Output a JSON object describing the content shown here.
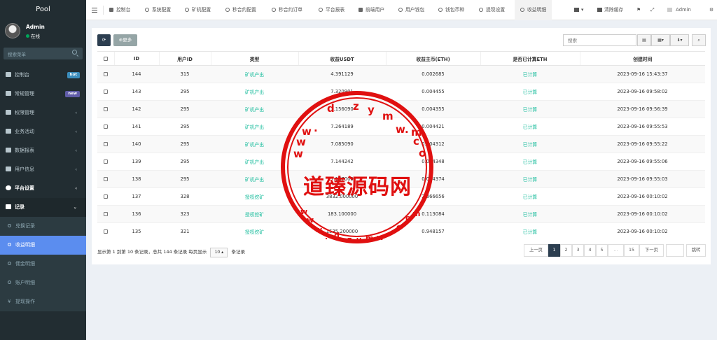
{
  "brand": "Pool",
  "user": {
    "name": "Admin",
    "status": "在线"
  },
  "sidebar": {
    "search_placeholder": "搜索菜单",
    "items": [
      {
        "label": "控制台",
        "badge": "hot",
        "badge_color": "#3c8dbc"
      },
      {
        "label": "常规管理",
        "badge": "new",
        "badge_color": "#605ca8"
      },
      {
        "label": "权限管理"
      },
      {
        "label": "业务活动"
      },
      {
        "label": "数据报表"
      },
      {
        "label": "用户信息"
      },
      {
        "label": "平台设置"
      },
      {
        "label": "记录"
      }
    ],
    "sub_items": [
      {
        "label": "兑换记录"
      },
      {
        "label": "收益明细"
      },
      {
        "label": "佣金明细"
      },
      {
        "label": "账户明细"
      },
      {
        "label": "提现操作"
      }
    ]
  },
  "topnav": {
    "tabs": [
      "控制台",
      "系统配置",
      "矿机配置",
      "秒合约配置",
      "秒合约订单",
      "平台报表",
      "前端用户",
      "用户钱包",
      "钱包币种",
      "提现设置",
      "收益明细"
    ],
    "clear_cache": "清除缓存",
    "admin": "Admin"
  },
  "toolbar": {
    "more_label": "更多",
    "search_placeholder": "搜索"
  },
  "table": {
    "headers": [
      "ID",
      "用户ID",
      "类型",
      "收益USDT",
      "收益主币(ETH)",
      "是否已计算ETH",
      "创建时间"
    ],
    "rows": [
      {
        "id": "144",
        "uid": "315",
        "type": "矿机产出",
        "usdt": "4.391129",
        "eth": "0.002685",
        "calc": "已计算",
        "time": "2023-09-16 15:43:37"
      },
      {
        "id": "143",
        "uid": "295",
        "type": "矿机产出",
        "usdt": "7.320901",
        "eth": "0.004455",
        "calc": "已计算",
        "time": "2023-09-16 09:58:02"
      },
      {
        "id": "142",
        "uid": "295",
        "type": "矿机产出",
        "usdt": "7.156090",
        "eth": "0.004355",
        "calc": "已计算",
        "time": "2023-09-16 09:56:39"
      },
      {
        "id": "141",
        "uid": "295",
        "type": "矿机产出",
        "usdt": "7.264189",
        "eth": "0.004421",
        "calc": "已计算",
        "time": "2023-09-16 09:55:53"
      },
      {
        "id": "140",
        "uid": "295",
        "type": "矿机产出",
        "usdt": "7.085090",
        "eth": "0.004312",
        "calc": "已计算",
        "time": "2023-09-16 09:55:22"
      },
      {
        "id": "139",
        "uid": "295",
        "type": "矿机产出",
        "usdt": "7.144242",
        "eth": "0.004348",
        "calc": "已计算",
        "time": "2023-09-16 09:55:06"
      },
      {
        "id": "138",
        "uid": "295",
        "type": "矿机产出",
        "usdt": "7.187000",
        "eth": "0.004374",
        "calc": "已计算",
        "time": "2023-09-16 09:55:03"
      },
      {
        "id": "137",
        "uid": "328",
        "type": "授权挖矿",
        "usdt": "3832.000000",
        "eth": "2.366656",
        "calc": "已计算",
        "time": "2023-09-16 00:10:02"
      },
      {
        "id": "136",
        "uid": "323",
        "type": "授权挖矿",
        "usdt": "183.100000",
        "eth": "0.113084",
        "calc": "已计算",
        "time": "2023-09-16 00:10:02"
      },
      {
        "id": "135",
        "uid": "321",
        "type": "授权挖矿",
        "usdt": "1535.200000",
        "eth": "0.948157",
        "calc": "已计算",
        "time": "2023-09-16 00:10:02"
      }
    ]
  },
  "footer": {
    "summary": "显示第 1 到第 10 条记录，总共 144 条记录 每页显示",
    "page_size": "10",
    "suffix": "条记录",
    "prev": "上一页",
    "pages": [
      "1",
      "2",
      "3",
      "4",
      "5",
      "...",
      "15"
    ],
    "next": "下一页",
    "jump": "跳转"
  },
  "watermark": {
    "text": "道臻源码网",
    "letters_top": [
      "w",
      "w",
      "w",
      ".",
      "d",
      "z",
      "y",
      "m",
      "w",
      ".",
      "c",
      "o",
      "m"
    ],
    "letters_bottom": [
      "w",
      "w",
      "w",
      ".",
      "d",
      "z",
      "y",
      "m",
      "w",
      ".",
      "c",
      "o",
      "m"
    ]
  },
  "colors": {
    "accent": "#5b8def",
    "sidebar": "#222d32",
    "green_text": "#18bc9c",
    "stamp": "#e01010"
  }
}
